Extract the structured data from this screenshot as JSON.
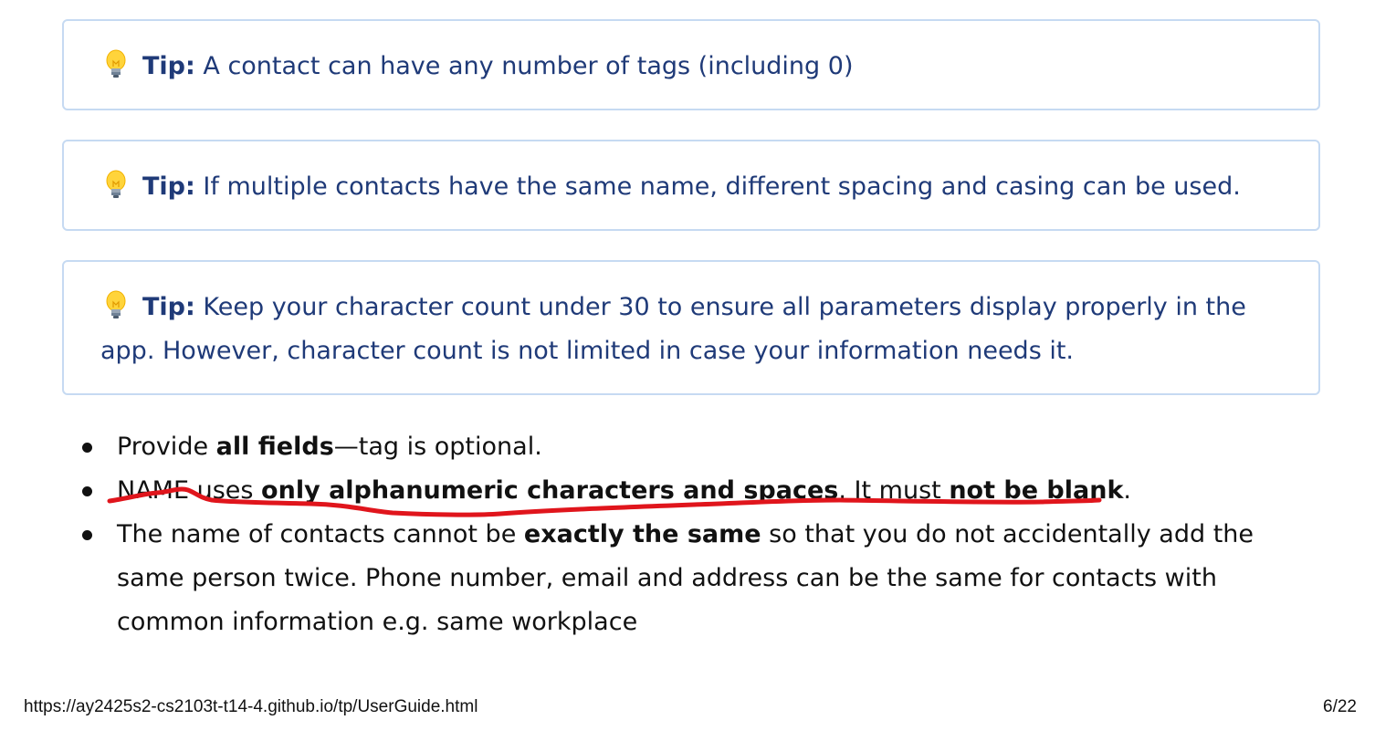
{
  "tips": [
    {
      "icon": "lightbulb-icon",
      "label": "Tip:",
      "lines": [
        "A contact can have any number of tags (including 0)"
      ]
    },
    {
      "icon": "lightbulb-icon",
      "label": "Tip:",
      "lines": [
        "If multiple contacts have the same name, different spacing and casing can be used."
      ]
    },
    {
      "icon": "lightbulb-icon",
      "label": "Tip:",
      "lines": [
        "Keep your character count under 30 to ensure all parameters display properly in the",
        "app. However, character count is not limited in case your information needs it."
      ]
    }
  ],
  "bullets": [
    {
      "parts": [
        {
          "text": "Provide ",
          "bold": false
        },
        {
          "text": "all fields",
          "bold": true
        },
        {
          "text": "—tag is optional.",
          "bold": false
        }
      ]
    },
    {
      "parts": [
        {
          "text": "NAME uses ",
          "bold": false
        },
        {
          "text": "only alphanumeric characters and spaces",
          "bold": true
        },
        {
          "text": ". It must ",
          "bold": false
        },
        {
          "text": "not be blank",
          "bold": true
        },
        {
          "text": ".",
          "bold": false
        }
      ]
    },
    {
      "parts": [
        {
          "text": "The name of contacts cannot be ",
          "bold": false
        },
        {
          "text": "exactly the same",
          "bold": true
        },
        {
          "text": " so that you do not accidentally add the",
          "bold": false
        }
      ],
      "continuation": [
        "same person twice. Phone number, email and address can be the same for contacts with",
        "common information e.g. same workplace"
      ]
    }
  ],
  "footer": {
    "url": "https://ay2425s2-cs2103t-t14-4.github.io/tp/UserGuide.html",
    "page": "6/22"
  },
  "colors": {
    "tip_text": "#1f3a78",
    "tip_border": "#c6daf2",
    "annotation": "#e0151c"
  }
}
